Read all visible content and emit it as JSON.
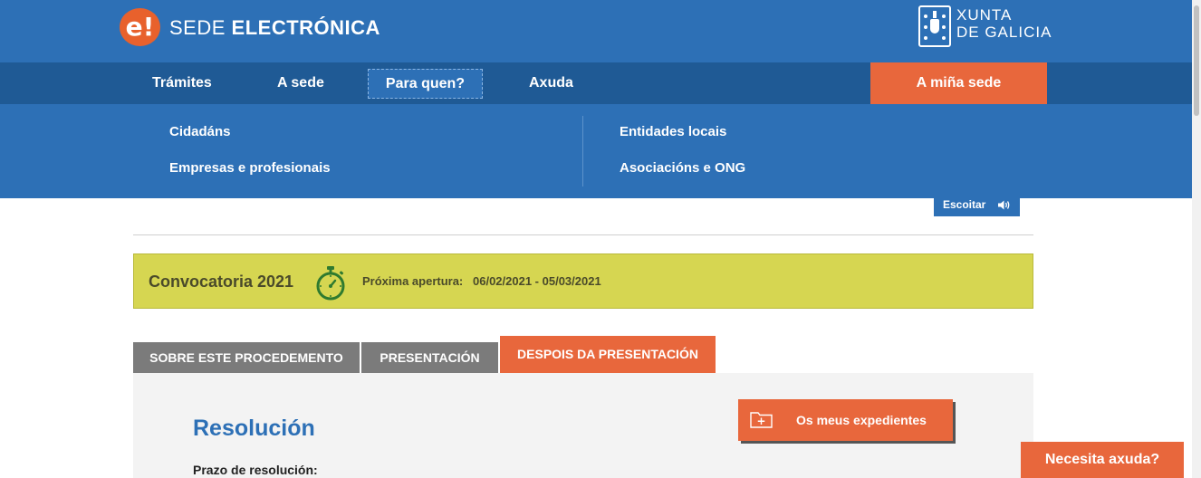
{
  "header": {
    "logo_letter": "e!",
    "brand_light": "SEDE ",
    "brand_bold": "ELECTRÓNICA",
    "xunta_line1": "XUNTA",
    "xunta_line2": "DE GALICIA"
  },
  "nav": {
    "items": [
      {
        "label": "Trámites"
      },
      {
        "label": "A sede"
      },
      {
        "label": "Para quen?"
      },
      {
        "label": "Axuda"
      }
    ],
    "my_sede": "A miña sede"
  },
  "dropdown": {
    "left": [
      "Cidadáns",
      "Empresas e profesionais"
    ],
    "right": [
      "Entidades locais",
      "Asociacións e ONG"
    ]
  },
  "listen": {
    "label": "Escoitar",
    "icon": "speaker-icon"
  },
  "convocatoria": {
    "title": "Convocatoria 2021",
    "icon": "stopwatch-icon",
    "label": "Próxima apertura:",
    "dates": "06/02/2021 - 05/03/2021"
  },
  "tabs": [
    {
      "label": "SOBRE ESTE PROCEDEMENTO"
    },
    {
      "label": "PRESENTACIÓN"
    },
    {
      "label": "DESPOIS DA PRESENTACIÓN"
    }
  ],
  "active_tab_index": 2,
  "panel": {
    "title": "Resolución",
    "subtitle": "Prazo de resolución:"
  },
  "expedientes_button": {
    "label": "Os meus expedientes",
    "icon": "folder-plus-icon"
  },
  "help_button": {
    "label": "Necesita axuda?"
  },
  "colors": {
    "primary_blue": "#2d70b6",
    "nav_dark_blue": "#1f5a95",
    "accent_orange": "#e8673c",
    "convocatoria_yellow": "#d6d651",
    "tab_gray": "#7b7b7b"
  }
}
